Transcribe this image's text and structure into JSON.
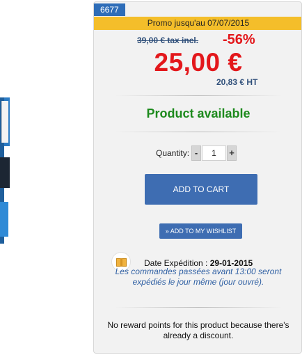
{
  "product": {
    "reference": "6677",
    "promo_banner": "Promo jusqu'au 07/07/2015",
    "old_price": "39,00 € tax incl.",
    "discount": "-56%",
    "price": "25,00 €",
    "price_ht": "20,83 € HT",
    "availability": "Product available"
  },
  "purchase": {
    "quantity_label": "Quantity:",
    "quantity_value": "1",
    "minus": "-",
    "plus": "+",
    "add_to_cart": "ADD TO CART",
    "add_to_wishlist": "» ADD TO MY WISHLIST"
  },
  "shipping": {
    "label": "Date Expédition :",
    "date": "29-01-2015",
    "note": "Les commandes passées avant 13:00 seront expédiés le jour même (jour ouvré)."
  },
  "reward_text": "No reward points for this product because there's already a discount.",
  "icons": {
    "shipping": "package-icon"
  },
  "colors": {
    "accent_blue": "#3e6db2",
    "promo_yellow": "#f4be2a",
    "price_red": "#e3171b",
    "available_green": "#1d8a1d"
  }
}
